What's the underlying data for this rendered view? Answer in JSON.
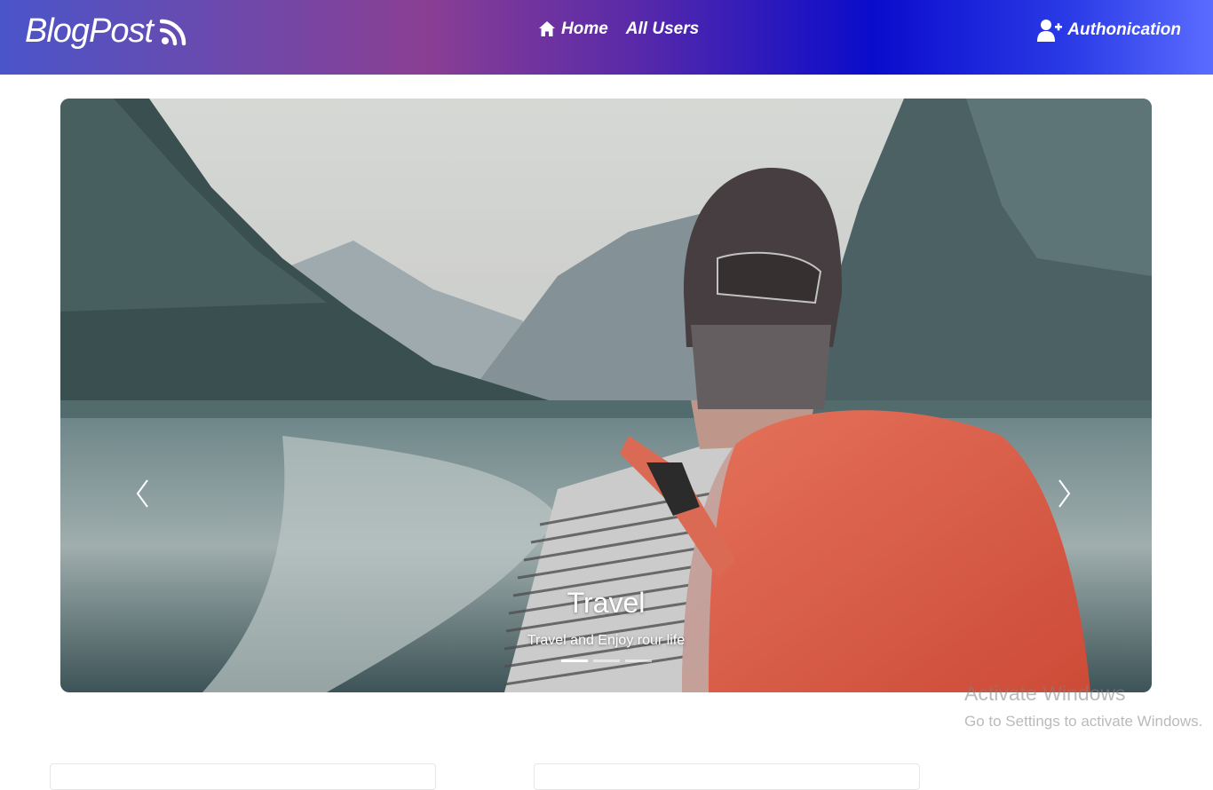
{
  "navbar": {
    "brand": "BlogPost",
    "links": [
      {
        "label": "Home",
        "icon": "home-icon"
      },
      {
        "label": "All Users"
      }
    ],
    "auth": {
      "label": "Authonication",
      "icon": "user-plus-icon"
    },
    "colors": {
      "start": "#4a55c9",
      "mid": "#8a3f93",
      "deep": "#0a0ccc",
      "end": "#5a6cff"
    }
  },
  "carousel": {
    "slide": {
      "title": "Travel",
      "subtitle": "Travel and Enjoy rour life"
    },
    "active_index": 0,
    "indicator_count": 3,
    "controls": {
      "prev_icon": "chevron-left-icon",
      "next_icon": "chevron-right-icon"
    }
  },
  "watermark": {
    "title": "Activate Windows",
    "subtitle": "Go to Settings to activate Windows."
  }
}
